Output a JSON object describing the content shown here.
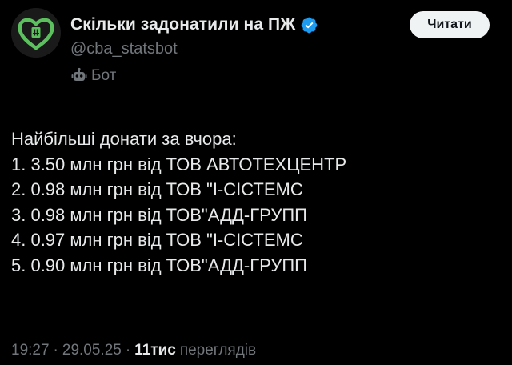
{
  "account": {
    "display_name": "Скільки задонатили на ПЖ",
    "handle": "@cba_statsbot",
    "bot_label": "Бот",
    "verified": true,
    "avatar_icon": "green-heart-logo-icon"
  },
  "follow_button": {
    "label": "Читати"
  },
  "tweet": {
    "lines": [
      "Найбільші донати за вчора:",
      "1. 3.50 млн грн від ТОВ АВТОТЕХЦЕНТР",
      "2. 0.98 млн грн від ТОВ \"І-СІСТЕМС",
      "3. 0.98 млн грн від ТОВ\"АДД-ГРУПП",
      "4. 0.97 млн грн від ТОВ \"І-СІСТЕМС",
      "5. 0.90 млн грн від ТОВ\"АДД-ГРУПП"
    ]
  },
  "meta": {
    "time": "19:27",
    "date": "29.05.25",
    "separator": "·",
    "views_count": "11тис",
    "views_label": "переглядів"
  },
  "colors": {
    "background": "#000000",
    "text_primary": "#e7e9ea",
    "text_secondary": "#71767b",
    "verified_blue": "#1d9bf0",
    "brand_green": "#4caf50",
    "button_bg": "#eff3f4"
  }
}
